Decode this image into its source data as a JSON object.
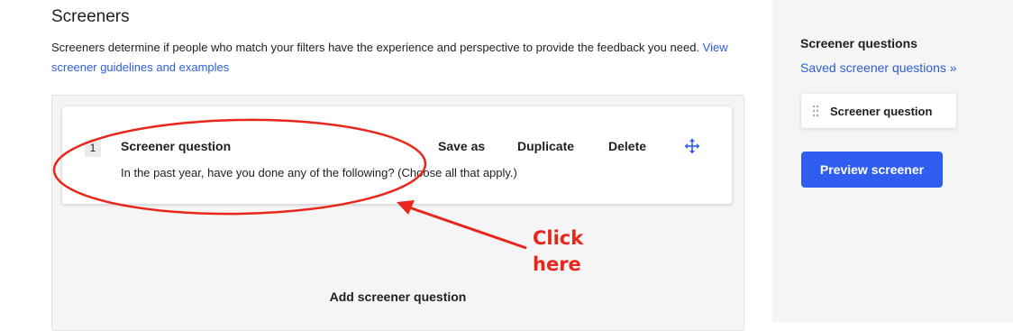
{
  "main": {
    "title": "Screeners",
    "description": "Screeners determine if people who match your filters have the experience and perspective to provide the feedback you need.",
    "guidelines_link": "View screener guidelines and examples",
    "questions": [
      {
        "number": "1",
        "title": "Screener question",
        "text": "In the past year, have you done any of the following? (Choose all that apply.)"
      }
    ],
    "actions": {
      "save_as": "Save as",
      "duplicate": "Duplicate",
      "delete": "Delete"
    },
    "add_question": "Add screener question"
  },
  "sidebar": {
    "heading": "Screener questions",
    "saved_link": "Saved screener questions »",
    "items": [
      {
        "label": "Screener question"
      }
    ],
    "preview_button": "Preview screener"
  },
  "annotation": {
    "callout_line1": "Click",
    "callout_line2": "here",
    "color": "#e8261b"
  },
  "colors": {
    "link": "#2c5fd9",
    "primary_button": "#2f5df0",
    "sidebar_bg": "#f5f5f5"
  },
  "icons": {
    "move": "move-arrows-icon",
    "drag": "drag-handle-icon"
  }
}
